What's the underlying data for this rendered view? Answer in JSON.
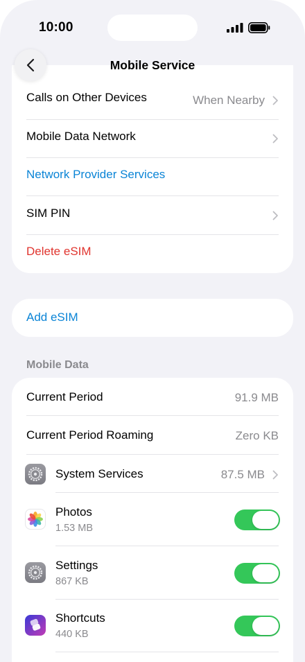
{
  "status_bar": {
    "time": "10:00"
  },
  "nav": {
    "title": "Mobile Service"
  },
  "group1": {
    "calls_on_other_devices": {
      "label": "Calls on Other Devices",
      "value": "When Nearby"
    },
    "mobile_data_network": {
      "label": "Mobile Data Network"
    },
    "network_provider_services": {
      "label": "Network Provider Services"
    },
    "sim_pin": {
      "label": "SIM PIN"
    },
    "delete_esim": {
      "label": "Delete eSIM"
    }
  },
  "group2": {
    "add_esim": {
      "label": "Add eSIM"
    }
  },
  "mobile_data": {
    "header": "Mobile Data",
    "current_period": {
      "label": "Current Period",
      "value": "91.9 MB"
    },
    "current_period_roaming": {
      "label": "Current Period Roaming",
      "value": "Zero KB"
    },
    "system_services": {
      "label": "System Services",
      "value": "87.5 MB"
    },
    "apps": [
      {
        "name": "Photos",
        "usage": "1.53 MB",
        "enabled": true
      },
      {
        "name": "Settings",
        "usage": "867 KB",
        "enabled": true
      },
      {
        "name": "Shortcuts",
        "usage": "440 KB",
        "enabled": true
      }
    ]
  },
  "colors": {
    "accent": "#0A84D6",
    "destructive": "#E0342E",
    "toggle_on": "#34C759",
    "background": "#F2F2F7"
  },
  "icons": [
    "back-chevron-icon",
    "chevron-right-icon",
    "gear-icon",
    "photos-icon",
    "shortcuts-icon",
    "signal-icon",
    "battery-icon"
  ]
}
